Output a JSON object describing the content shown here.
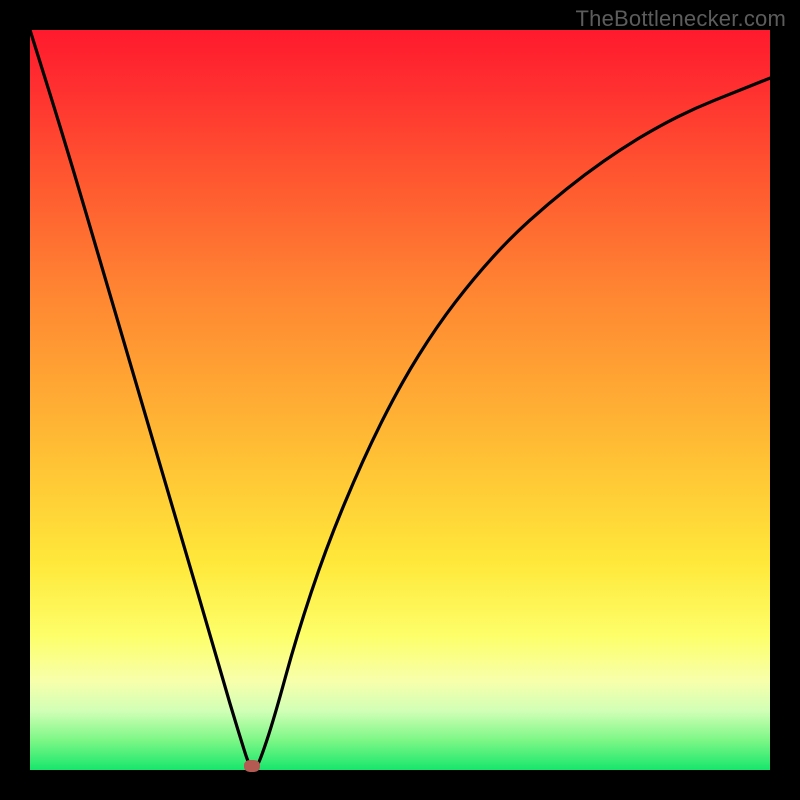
{
  "watermark": "TheBottlenecker.com",
  "colors": {
    "frame": "#000000",
    "curve": "#000000",
    "marker": "#b55a53",
    "gradient_top": "#ff1a2d",
    "gradient_bottom": "#17e66c"
  },
  "chart_data": {
    "type": "line",
    "title": "",
    "xlabel": "",
    "ylabel": "",
    "xlim": [
      0,
      100
    ],
    "ylim": [
      0,
      100
    ],
    "grid": false,
    "legend": false,
    "series": [
      {
        "name": "bottleneck-curve",
        "x": [
          0,
          5,
          10,
          15,
          20,
          25,
          27,
          29,
          29.5,
          30,
          30.5,
          31,
          33,
          36,
          40,
          45,
          50,
          55,
          60,
          65,
          70,
          75,
          80,
          85,
          90,
          95,
          100
        ],
        "y": [
          100,
          84,
          67,
          50,
          33,
          16,
          9,
          2.5,
          1,
          0.5,
          0.5,
          1,
          7,
          18,
          30,
          42,
          52,
          60,
          66.5,
          72,
          76.5,
          80.5,
          84,
          87,
          89.5,
          91.5,
          93.5
        ]
      }
    ],
    "marker": {
      "x": 30,
      "y": 0.5
    },
    "annotations": []
  }
}
